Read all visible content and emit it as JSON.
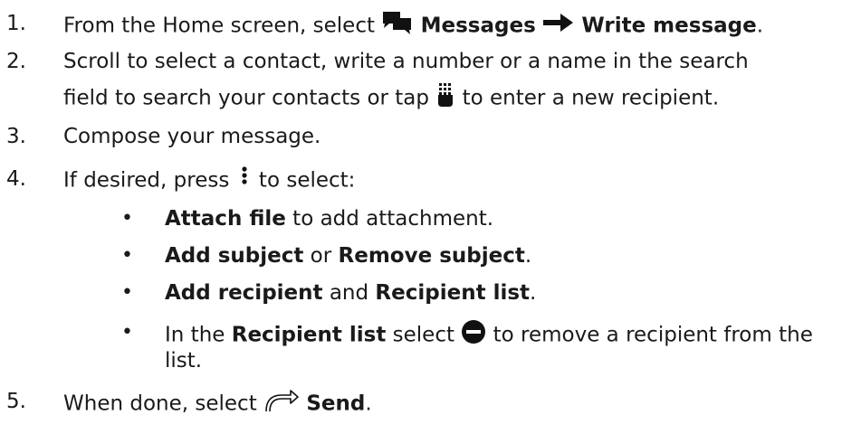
{
  "steps": [
    {
      "num": "1.",
      "pre": "From the Home screen, select ",
      "b1": "Messages",
      "b2": "Write message",
      "post": "."
    },
    {
      "num": "2.",
      "line1": "Scroll to select a contact, write a number or a name in the search",
      "line2_pre": "field to search your contacts or tap ",
      "line2_post": " to enter a new recipient."
    },
    {
      "num": "3.",
      "text": "Compose your message."
    },
    {
      "num": "4.",
      "pre": "If desired, press ",
      "post": " to select:"
    },
    {
      "num": "5.",
      "pre": "When done, select ",
      "b": "Send",
      "post": "."
    }
  ],
  "bullets": [
    {
      "marker": "•",
      "b1": "Attach file",
      "t1": " to add attachment."
    },
    {
      "marker": "•",
      "b1": "Add subject",
      "t1": " or ",
      "b2": "Remove subject",
      "t2": "."
    },
    {
      "marker": "•",
      "b1": "Add recipient",
      "t1": " and ",
      "b2": "Recipient list",
      "t2": "."
    },
    {
      "marker": "•",
      "pre": "In the ",
      "b1": "Recipient list",
      "t1": " select ",
      "t2": " to remove a recipient from the",
      "line2": "list."
    }
  ],
  "icons": [
    "messages-icon",
    "arrow-right-icon",
    "keypad-icon",
    "more-vert-icon",
    "remove-circle-icon",
    "send-icon"
  ]
}
